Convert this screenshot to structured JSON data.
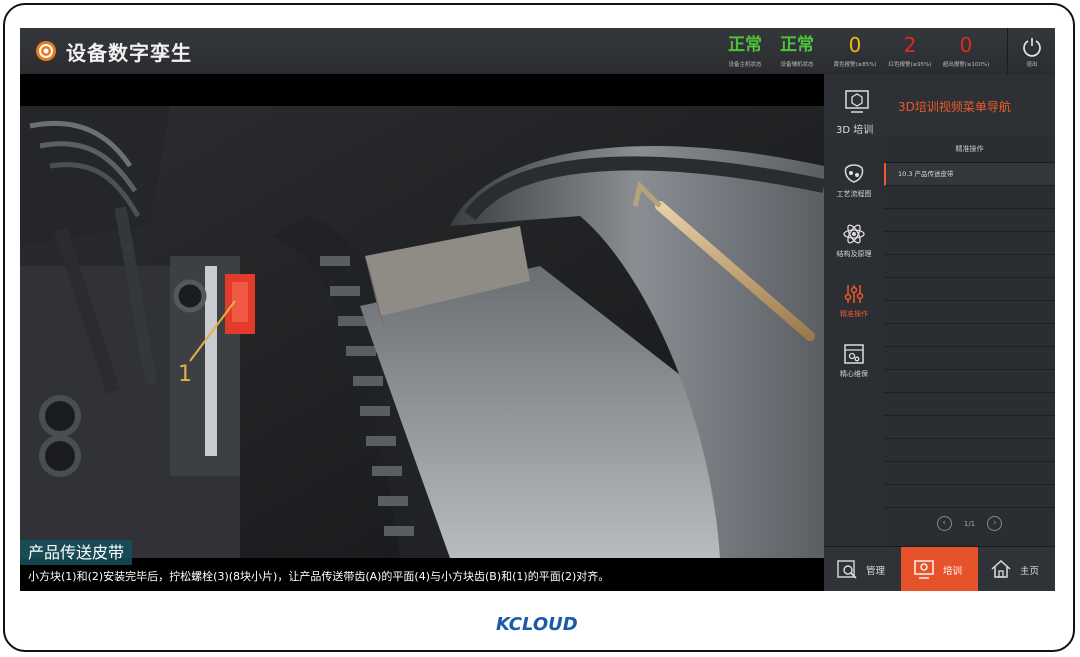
{
  "header": {
    "title": "设备数字孪生",
    "stats": [
      {
        "value": "正常",
        "label": "设备主机状态",
        "color": "#4ec33a"
      },
      {
        "value": "正常",
        "label": "设备辅机状态",
        "color": "#4ec33a"
      },
      {
        "value": "0",
        "label": "黄色报警(≥85%)",
        "color": "#f1b51c"
      },
      {
        "value": "2",
        "label": "红色报警(≥95%)",
        "color": "#e0281c"
      },
      {
        "value": "0",
        "label": "超出报警(≥100%)",
        "color": "#e0281c"
      }
    ],
    "exit_label": "退出"
  },
  "video": {
    "marker": "1",
    "caption_title": "产品传送皮带",
    "caption_text": "小方块(1)和(2)安装完毕后，拧松螺栓(3)(8块小片)，让产品传送带齿(A)的平面(4)与小方块齿(B)和(1)的平面(2)对齐。"
  },
  "panel": {
    "train_label": "3D 培训",
    "nav_title": "3D培训视频菜单导航",
    "side": [
      {
        "label": "工艺流程图",
        "icon": "process-icon"
      },
      {
        "label": "结构及原理",
        "icon": "atom-icon"
      },
      {
        "label": "精准操作",
        "icon": "sliders-icon"
      },
      {
        "label": "精心维保",
        "icon": "maintenance-icon"
      }
    ],
    "active_side": 2,
    "list_header": "精准操作",
    "list_items": [
      "10.3 产品传送皮带"
    ],
    "page": "1/1"
  },
  "bottom_nav": [
    {
      "label": "管理",
      "icon": "manage-icon"
    },
    {
      "label": "培训",
      "icon": "training-icon"
    },
    {
      "label": "主页",
      "icon": "home-icon"
    }
  ],
  "brand": "KCLOUD",
  "colors": {
    "accent": "#e6532a",
    "ok": "#4ec33a",
    "warn": "#f1b51c",
    "alarm": "#e0281c"
  }
}
